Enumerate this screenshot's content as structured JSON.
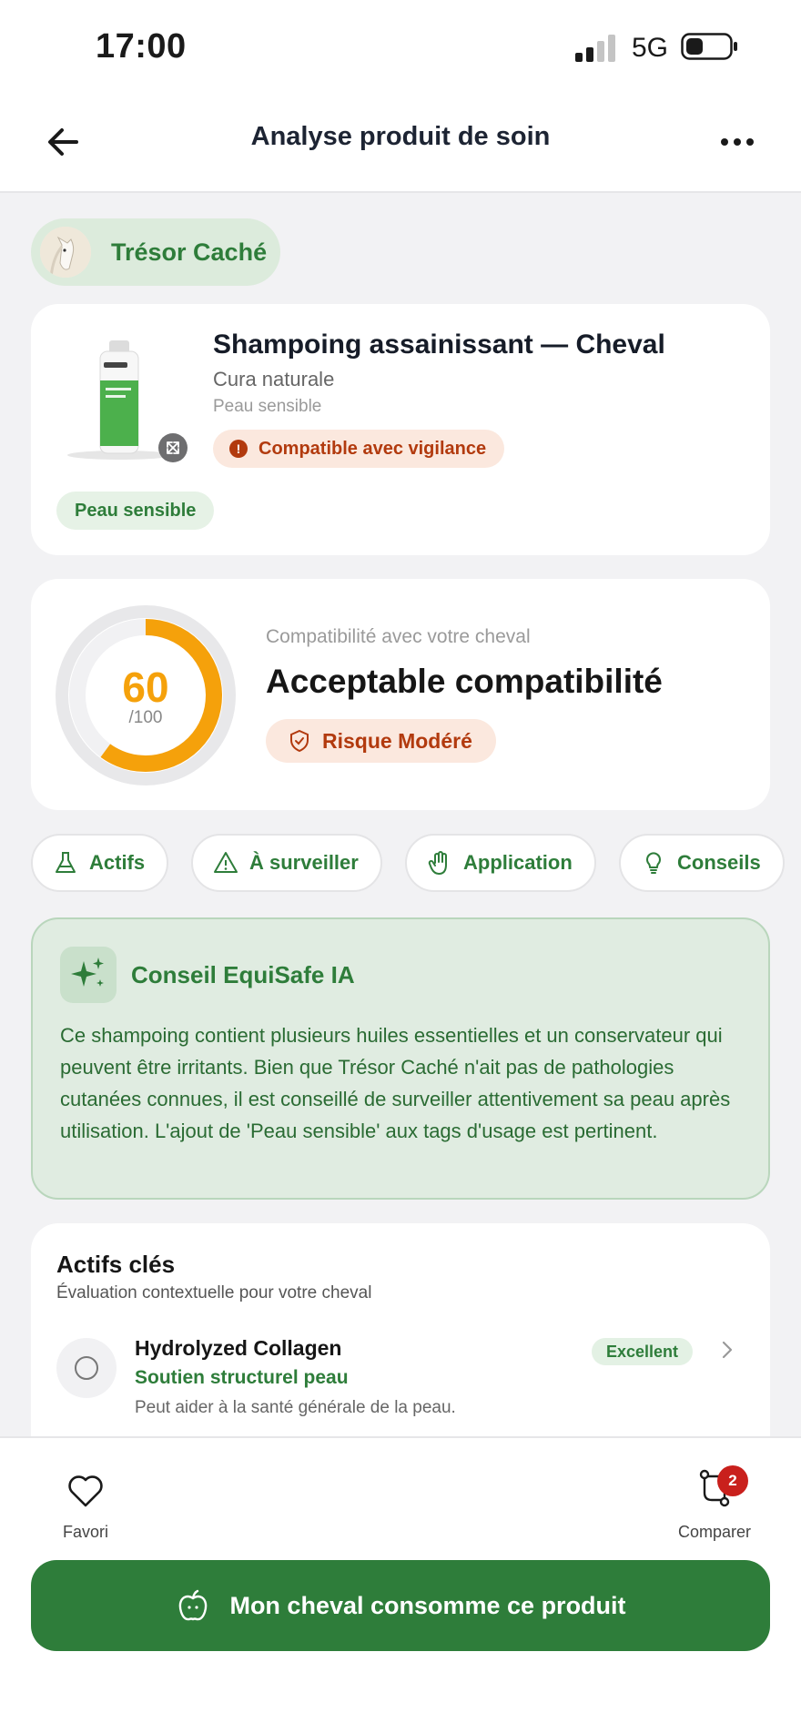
{
  "status_bar": {
    "time": "17:00",
    "network": "5G"
  },
  "header": {
    "title": "Analyse produit de soin",
    "back_icon": "arrow-left-icon",
    "more_icon": "more-horizontal-icon"
  },
  "horse": {
    "name": "Trésor Caché"
  },
  "product": {
    "name": "Shampoing assainissant — Cheval",
    "brand": "Cura naturale",
    "category": "Peau sensible",
    "compatibility_badge": "Compatible avec vigilance",
    "tag": "Peau sensible"
  },
  "score": {
    "value": "60",
    "max": "/100",
    "fraction": 0.6,
    "label": "Compatibilité avec votre cheval",
    "title": "Acceptable compatibilité",
    "risk": "Risque Modéré"
  },
  "tabs": [
    {
      "label": "Actifs",
      "icon": "flask-icon"
    },
    {
      "label": "À surveiller",
      "icon": "warning-icon"
    },
    {
      "label": "Application",
      "icon": "hand-icon"
    },
    {
      "label": "Conseils",
      "icon": "lightbulb-icon"
    }
  ],
  "ai_advice": {
    "title": "Conseil EquiSafe IA",
    "text": "Ce shampoing contient plusieurs huiles essentielles et un conservateur qui peuvent être irritants. Bien que Trésor Caché n'ait pas de pathologies cutanées connues, il est conseillé de surveiller attentivement sa peau après utilisation. L'ajout de 'Peau sensible' aux tags d'usage est pertinent."
  },
  "actifs": {
    "title": "Actifs clés",
    "subtitle": "Évaluation contextuelle pour votre cheval",
    "items": [
      {
        "name": "Hydrolyzed Collagen",
        "role": "Soutien structurel peau",
        "description": "Peut aider à la santé générale de la peau.",
        "rating": "Excellent"
      }
    ]
  },
  "bottom_bar": {
    "favorite_label": "Favori",
    "compare_label": "Comparer",
    "compare_count": "2",
    "cta_label": "Mon cheval consomme ce produit"
  },
  "colors": {
    "primary_green": "#2e7d3a",
    "warning_orange": "#b23a0e",
    "score_orange": "#f5a10b"
  }
}
